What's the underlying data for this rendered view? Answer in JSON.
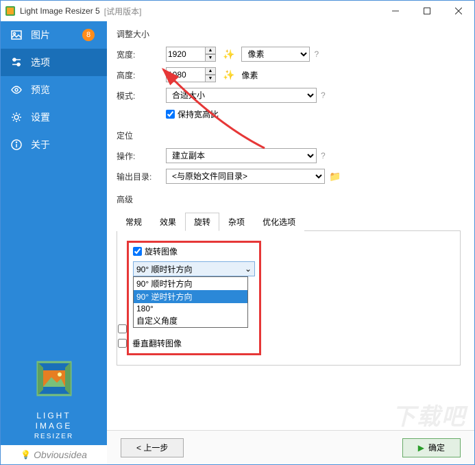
{
  "window": {
    "title": "Light Image Resizer 5",
    "trial": "[试用版本]"
  },
  "sidebar": {
    "items": [
      {
        "label": "图片",
        "badge": "8"
      },
      {
        "label": "选项"
      },
      {
        "label": "预览"
      },
      {
        "label": "设置"
      },
      {
        "label": "关于"
      }
    ],
    "brand_line1": "LIGHT",
    "brand_line2": "IMAGE",
    "brand_line3": "RESIZER",
    "obvious": "Obviousidea"
  },
  "resize": {
    "section": "调整大小",
    "width_label": "宽度:",
    "width_value": "1920",
    "height_label": "高度:",
    "height_value": "1080",
    "unit_label": "像素",
    "mode_label": "模式:",
    "mode_value": "合适大小",
    "keep_ratio": "保持宽高比"
  },
  "position": {
    "section": "定位",
    "op_label": "操作:",
    "op_value": "建立副本",
    "out_label": "输出目录:",
    "out_value": "<与原始文件同目录>"
  },
  "advanced": {
    "section": "高级",
    "tabs": [
      "常规",
      "效果",
      "旋转",
      "杂项",
      "优化选项"
    ],
    "rotate_chk": "旋转图像",
    "dropdown_selected": "90° 顺时针方向",
    "dropdown_options": [
      "90° 顺时针方向",
      "90° 逆时针方向",
      "180°",
      "自定义角度"
    ],
    "flip_h": "",
    "flip_v": "垂直翻转图像"
  },
  "footer": {
    "back": "< 上一步",
    "ok": "确定"
  },
  "watermark": "下载吧"
}
